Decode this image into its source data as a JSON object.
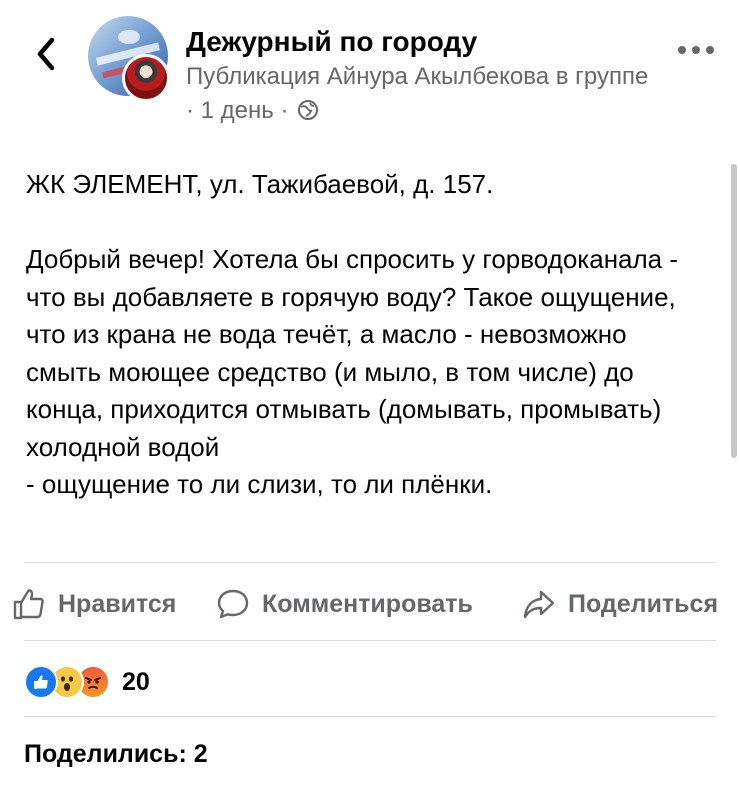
{
  "header": {
    "group_name": "Дежурный по городу",
    "meta_text": "Публикация Айнура Акылбекова в группе · 1 день ·",
    "icons": {
      "back": "chevron-left-icon",
      "more": "more-horizontal-icon",
      "privacy": "globe-icon"
    }
  },
  "post": {
    "text": "ЖК ЭЛЕМЕНТ, ул. Тажибаевой, д. 157.\n\nДобрый вечер! Хотела бы спросить у горводоканала - что вы добавляете в горячую воду? Такое ощущение, что из крана не вода течёт, а масло - невозможно смыть моющее средство (и мыло, в том числе) до конца, приходится отмывать (домывать, промывать) холодной водой\n- ощущение то ли слизи, то ли плёнки."
  },
  "actions": {
    "like_label": "Нравится",
    "comment_label": "Комментировать",
    "share_label": "Поделиться"
  },
  "reactions": {
    "count": "20",
    "types": [
      "like",
      "wow",
      "angry"
    ]
  },
  "shares": {
    "text": "Поделились: 2"
  },
  "colors": {
    "text": "#050505",
    "secondary": "#65676b",
    "divider": "#dadde1",
    "like_blue": "#1877f2"
  }
}
